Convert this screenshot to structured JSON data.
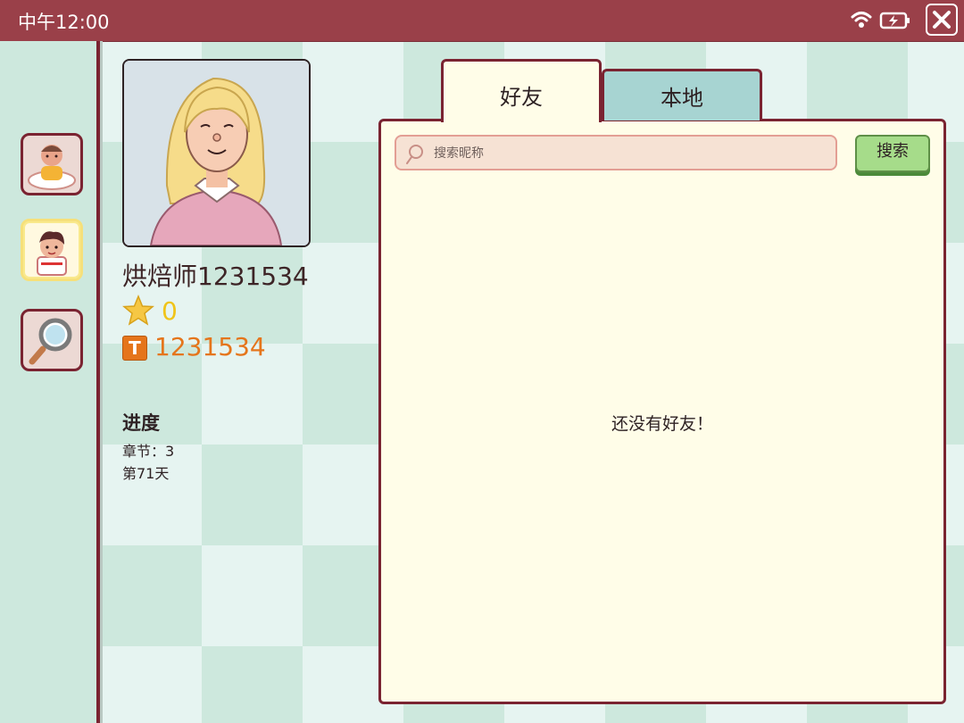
{
  "status_bar": {
    "time": "中午12:00",
    "wifi_icon": "wifi-icon",
    "battery_icon": "battery-charging-icon",
    "close_icon": "close-icon"
  },
  "sidebar": {
    "items": [
      {
        "name": "profile-baker",
        "icon": "baker-avatar-icon"
      },
      {
        "name": "friends",
        "icon": "kid-avatar-icon",
        "active": true
      },
      {
        "name": "search",
        "icon": "magnifier-icon"
      }
    ]
  },
  "profile": {
    "name": "烘焙师1231534",
    "stars": "0",
    "coins": "1231534",
    "coin_glyph": "T",
    "progress": {
      "title": "进度",
      "chapter": "章节：3",
      "day": "第71天"
    }
  },
  "tabs": [
    {
      "label": "好友",
      "active": true
    },
    {
      "label": "本地",
      "active": false
    }
  ],
  "search": {
    "placeholder": "搜索昵称",
    "value": "",
    "button_label": "搜索"
  },
  "friends": {
    "empty_message": "还没有好友！"
  },
  "colors": {
    "header": "#9a4049",
    "accent_dark": "#7a2331",
    "panel": "#fffde8",
    "button_green": "#a6dc8a",
    "coin_orange": "#e5751b",
    "star_yellow": "#f0c419"
  }
}
